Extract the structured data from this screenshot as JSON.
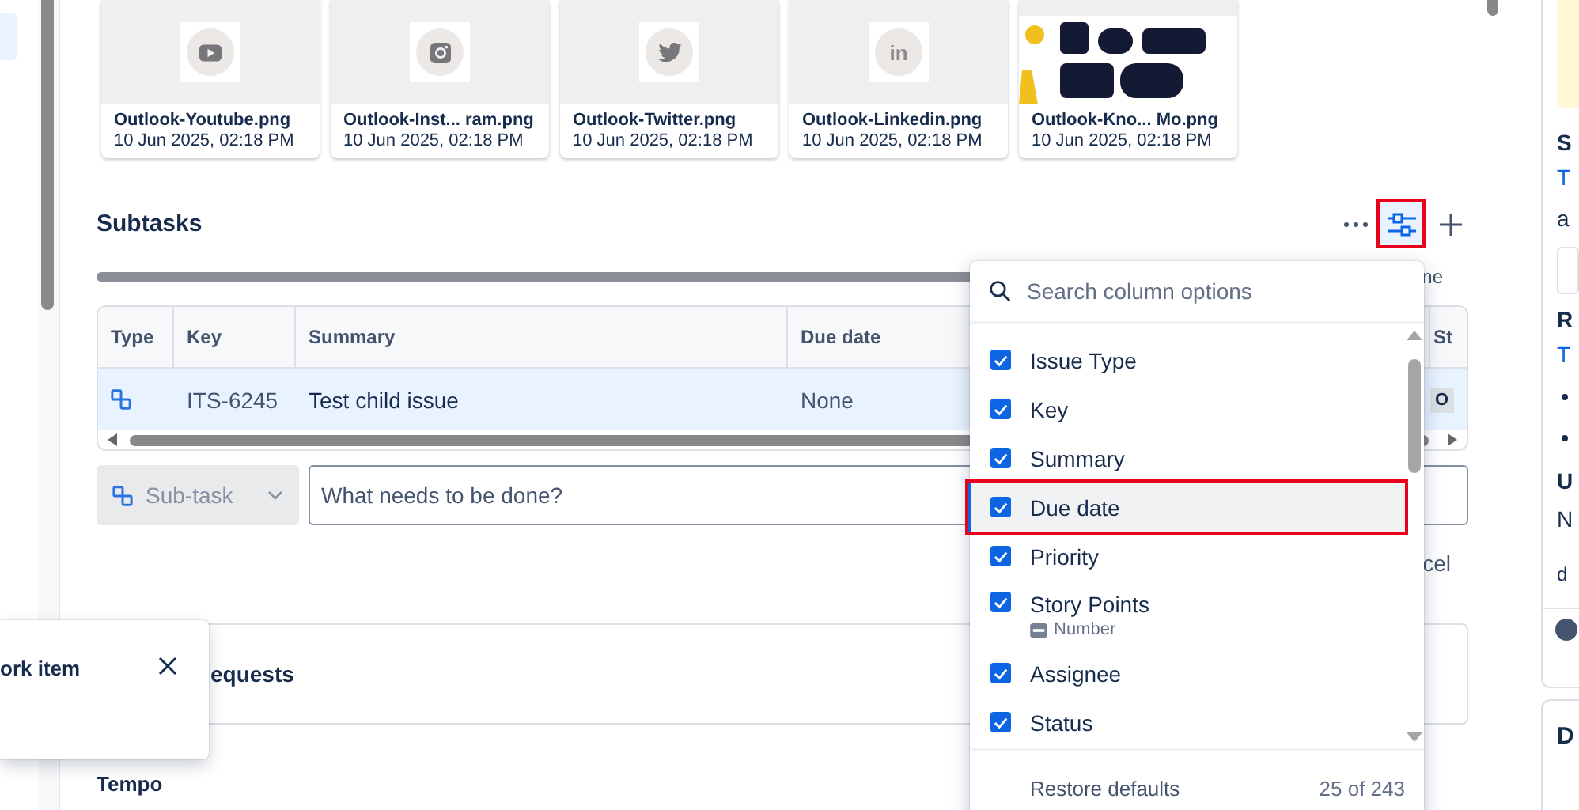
{
  "sidebar": {
    "items": [
      {
        "selected": true
      }
    ]
  },
  "attachments": [
    {
      "name": "Outlook-Youtube.png",
      "date": "10 Jun 2025, 02:18 PM",
      "kind": "video"
    },
    {
      "name": "Outlook-Inst... ram.png",
      "date": "10 Jun 2025, 02:18 PM",
      "kind": "camera"
    },
    {
      "name": "Outlook-Twitter.png",
      "date": "10 Jun 2025, 02:18 PM",
      "kind": "bird"
    },
    {
      "name": "Outlook-Linkedin.png",
      "date": "10 Jun 2025, 02:18 PM",
      "kind": "label",
      "icon_text": "in"
    },
    {
      "name": "Outlook-Kno... Mo.png",
      "date": "10 Jun 2025, 02:18 PM",
      "kind": "picture"
    }
  ],
  "subtasks": {
    "title": "Subtasks",
    "column_options_button": {
      "selected": true,
      "highlighted": true
    },
    "progress": {
      "level": 1,
      "label": "ne"
    },
    "table": {
      "columns": [
        "Type",
        "Key",
        "Summary",
        "Due date",
        "St"
      ],
      "rows": [
        {
          "selected": true,
          "key": "ITS-6245",
          "summary": "Test child issue",
          "due_date": "None",
          "status": "O"
        }
      ]
    },
    "create": {
      "type": "Sub-task",
      "placeholder": "What needs to be done?"
    },
    "cancel_label": "cel"
  },
  "requests_section": {
    "title": "equests"
  },
  "tempo_section": {
    "title": "Tempo"
  },
  "column_options": {
    "placeholder": "Search column options",
    "options": [
      {
        "label": "Issue Type",
        "checked": true,
        "focused": false
      },
      {
        "label": "Key",
        "checked": true,
        "focused": false
      },
      {
        "label": "Summary",
        "checked": true,
        "focused": false
      },
      {
        "label": "Due date",
        "checked": true,
        "focused": true
      },
      {
        "label": "Priority",
        "checked": true,
        "focused": false
      },
      {
        "label": "Story Points",
        "checked": true,
        "focused": false,
        "field_type": "Number"
      },
      {
        "label": "Assignee",
        "checked": true,
        "focused": false
      },
      {
        "label": "Status",
        "checked": true,
        "focused": false
      }
    ],
    "restore_label": "Restore defaults",
    "count": "25 of 243"
  },
  "toast": {
    "title": "ork item"
  },
  "right_panel": {
    "lines": [
      {
        "kind": "notice"
      },
      {
        "kind": "heading",
        "text": "S"
      },
      {
        "kind": "link",
        "text": "T"
      },
      {
        "kind": "text",
        "text": "a"
      },
      {
        "kind": "field"
      },
      {
        "kind": "heading",
        "text": "R"
      },
      {
        "kind": "link",
        "text": "T"
      },
      {
        "kind": "bullet"
      },
      {
        "kind": "bullet"
      },
      {
        "kind": "heading",
        "text": "U"
      },
      {
        "kind": "text",
        "text": "N"
      },
      {
        "kind": "small",
        "text": "d"
      },
      {
        "kind": "info"
      }
    ],
    "second_card": {
      "title": "D"
    }
  }
}
